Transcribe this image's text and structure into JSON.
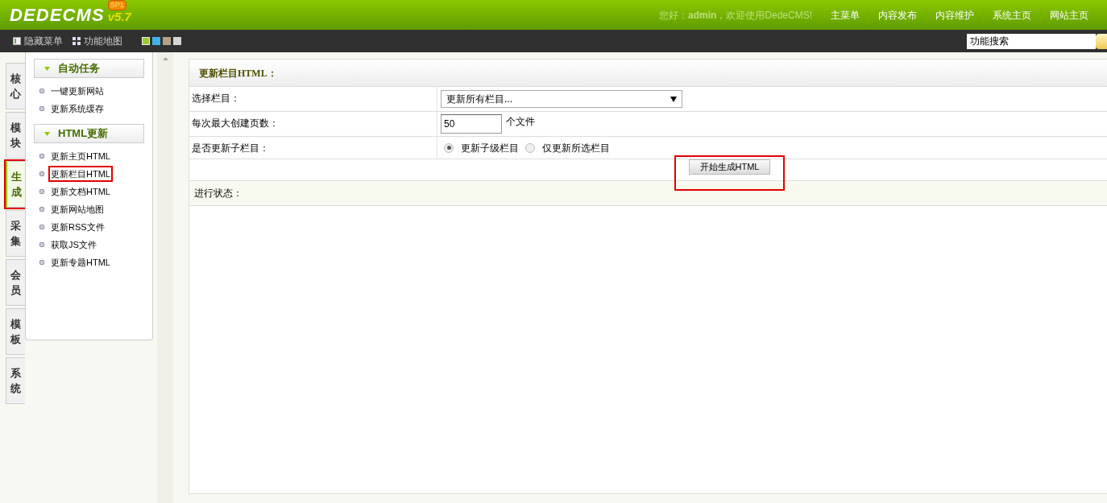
{
  "header": {
    "logo": "DEDECMS",
    "badge": "SP1",
    "version": "v5.7",
    "greeting_prefix": "您好：",
    "user": "admin",
    "greeting_suffix": "，欢迎使用DedeCMS!",
    "nav": [
      "主菜单",
      "内容发布",
      "内容维护",
      "系统主页",
      "网站主页"
    ]
  },
  "toolbar": {
    "items": [
      {
        "label": "隐藏菜单",
        "kind": "hide"
      },
      {
        "label": "功能地图",
        "kind": "map"
      }
    ],
    "skins": [
      {
        "color": "#9acd32",
        "selected": true
      },
      {
        "color": "#3fb3e6",
        "selected": false
      },
      {
        "color": "#b3a087",
        "selected": false
      },
      {
        "color": "#d5d5d5",
        "selected": false
      }
    ],
    "search": {
      "value": "功能搜索"
    }
  },
  "side_tabs": [
    {
      "label": "核心",
      "selected": false,
      "highlighted": false
    },
    {
      "label": "模块",
      "selected": false,
      "highlighted": false
    },
    {
      "label": "生成",
      "selected": true,
      "highlighted": true
    },
    {
      "label": "采集",
      "selected": false,
      "highlighted": false
    },
    {
      "label": "会员",
      "selected": false,
      "highlighted": false
    },
    {
      "label": "模板",
      "selected": false,
      "highlighted": false
    },
    {
      "label": "系统",
      "selected": false,
      "highlighted": false
    }
  ],
  "menu_groups": [
    {
      "title": "自动任务",
      "items": [
        {
          "label": "一键更新网站",
          "highlighted": false
        },
        {
          "label": "更新系统缓存",
          "highlighted": false
        }
      ]
    },
    {
      "title": "HTML更新",
      "items": [
        {
          "label": "更新主页HTML",
          "highlighted": false
        },
        {
          "label": "更新栏目HTML",
          "highlighted": true
        },
        {
          "label": "更新文档HTML",
          "highlighted": false
        },
        {
          "label": "更新网站地图",
          "highlighted": false
        },
        {
          "label": "更新RSS文件",
          "highlighted": false
        },
        {
          "label": "获取JS文件",
          "highlighted": false
        },
        {
          "label": "更新专题HTML",
          "highlighted": false
        }
      ]
    }
  ],
  "form": {
    "title": "更新栏目HTML：",
    "rows": [
      {
        "label": "选择栏目：",
        "kind": "select",
        "value": "更新所有栏目..."
      },
      {
        "label": "每次最大创建页数：",
        "kind": "number",
        "value": "50",
        "unit": "个文件"
      },
      {
        "label": "是否更新子栏目：",
        "kind": "radio",
        "options": [
          {
            "label": "更新子级栏目",
            "selected": true
          },
          {
            "label": "仅更新所选栏目",
            "selected": false
          }
        ]
      }
    ],
    "submit": {
      "label": "开始生成HTML",
      "highlighted": true
    },
    "status_label": "进行状态："
  }
}
